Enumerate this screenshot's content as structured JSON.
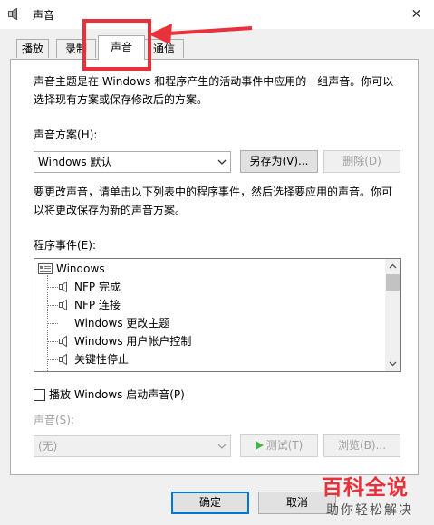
{
  "window": {
    "title": "声音",
    "close_glyph": "✕"
  },
  "tabs": [
    {
      "label": "播放",
      "active": false
    },
    {
      "label": "录制",
      "active": false
    },
    {
      "label": "声音",
      "active": true
    },
    {
      "label": "通信",
      "active": false
    }
  ],
  "sounds": {
    "intro": [
      "声音主题是在 Windows 和程序产生的活动事件中应用的一组声音。你可以",
      "选择现有方案或保存修改后的方案。"
    ],
    "scheme_label": "声音方案(H):",
    "scheme_value": "Windows 默认",
    "save_as_label": "另存为(V)...",
    "delete_label": "删除(D)",
    "change_note": [
      "要更改声音，请单击以下列表中的程序事件，然后选择要应用的声音。你可",
      "以将更改保存为新的声音方案。"
    ],
    "events_label": "程序事件(E):",
    "events": [
      {
        "label": "Windows",
        "icon": "windows-folder-icon"
      },
      {
        "label": "NFP 完成",
        "icon": "speaker-icon"
      },
      {
        "label": "NFP 连接",
        "icon": "speaker-icon"
      },
      {
        "label": "Windows 更改主题",
        "icon": ""
      },
      {
        "label": "Windows 用户帐户控制",
        "icon": "speaker-icon"
      },
      {
        "label": "关键性停止",
        "icon": "speaker-icon"
      }
    ],
    "startup_sound_label": "播放 Windows 启动声音(P)",
    "startup_sound_checked": false,
    "sound_label": "声音(S):",
    "sound_value": "(无)",
    "test_label": "测试(T)",
    "browse_label": "浏览(B)..."
  },
  "footer": {
    "ok_label": "确定",
    "cancel_label": "取消"
  },
  "watermark": {
    "main": "百科全说",
    "sub": "助你轻松解决"
  },
  "colors": {
    "annotation_red": "#e8313a",
    "focus_blue": "#0078d7",
    "dialog_bg": "#f0f0f0"
  }
}
